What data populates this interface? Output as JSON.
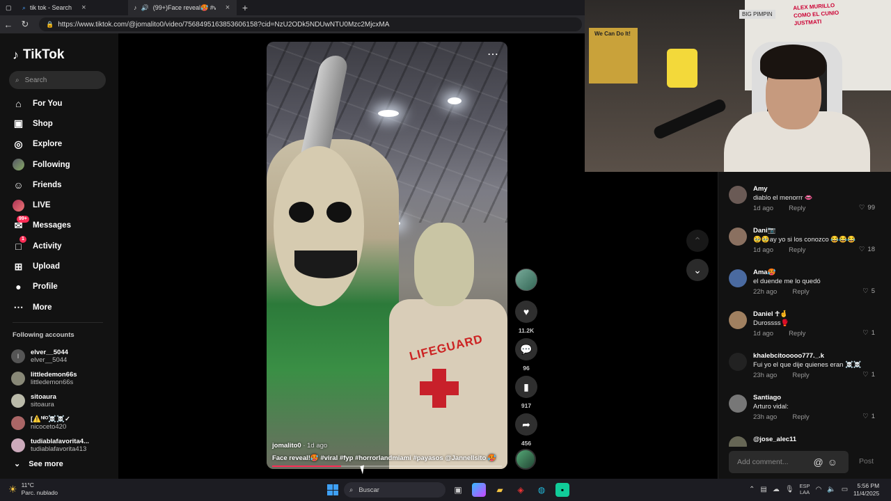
{
  "browser": {
    "tabs": [
      {
        "title": "tik tok - Search"
      },
      {
        "title": "(99+)Face reveal🥵 #viral #"
      }
    ],
    "new_tab": "+",
    "url": "https://www.tiktok.com/@jomalito0/video/7568495163853606158?cid=NzU2ODk5NDUwNTU0Mzc2MjcxMA"
  },
  "sidebar": {
    "logo": "TikTok",
    "search_placeholder": "Search",
    "nav": [
      {
        "label": "For You",
        "icon": "home-icon",
        "glyph": "⌂"
      },
      {
        "label": "Shop",
        "icon": "bag-icon",
        "glyph": "▣"
      },
      {
        "label": "Explore",
        "icon": "compass-icon",
        "glyph": "◎"
      },
      {
        "label": "Following",
        "icon": "following-avatar-icon",
        "glyph": ""
      },
      {
        "label": "Friends",
        "icon": "friends-icon",
        "glyph": "☺"
      },
      {
        "label": "LIVE",
        "icon": "live-avatar-icon",
        "glyph": ""
      },
      {
        "label": "Messages",
        "icon": "message-icon",
        "glyph": "✉",
        "badge": "99+"
      },
      {
        "label": "Activity",
        "icon": "bell-icon",
        "glyph": "□",
        "badge": "1"
      },
      {
        "label": "Upload",
        "icon": "upload-icon",
        "glyph": "⊞"
      },
      {
        "label": "Profile",
        "icon": "profile-icon",
        "glyph": "●"
      },
      {
        "label": "More",
        "icon": "more-icon",
        "glyph": "⋯"
      }
    ],
    "following_title": "Following accounts",
    "following": [
      {
        "name": "elver__5044",
        "handle": "elver__5044",
        "initial": "I"
      },
      {
        "name": "littledemon66s",
        "handle": "littledemon66s",
        "initial": ""
      },
      {
        "name": "sitoaura",
        "handle": "sitoaura",
        "initial": ""
      },
      {
        "name": "[⚠️ᴺˡᴼ☠️☠️✓",
        "handle": "nicoceto420",
        "initial": ""
      },
      {
        "name": "tudiablafavorita4...",
        "handle": "tudiablafavorita413",
        "initial": ""
      }
    ],
    "see_more": "See more"
  },
  "video": {
    "more": "⋯",
    "author": "jomalito0",
    "time": " · 1d ago",
    "caption": "Face reveal!🥵 #viral #fyp #horrorlandmiami #payasos @Jannellsito 🥵",
    "progress": 0.3,
    "shirt_text": "LIFEGUARD"
  },
  "actions": {
    "likes": "11.2K",
    "comments": "96",
    "saves": "917",
    "shares": "456"
  },
  "comments": [
    {
      "name": "Amy",
      "text": "diablo el menorrr 👄",
      "time": "1d ago",
      "reply": "Reply",
      "likes": "99"
    },
    {
      "name": "Dani📷",
      "text": "🥹🥹ay yo si los conozco 😂😂😂",
      "time": "1d ago",
      "reply": "Reply",
      "likes": "18"
    },
    {
      "name": "Ama🥵",
      "text": "el duende me lo quedó",
      "time": "22h ago",
      "reply": "Reply",
      "likes": "5"
    },
    {
      "name": "Daniel ☥️🤞",
      "text": "Durossss🥊",
      "time": "1d ago",
      "reply": "Reply",
      "likes": "1"
    },
    {
      "name": "khalebcitooooo777._.k",
      "text": "Fui yo el que dije quienes eran ☠️☠️",
      "time": "23h ago",
      "reply": "Reply",
      "likes": "1"
    },
    {
      "name": "Santiago",
      "text": "Arturo vidal:",
      "time": "23h ago",
      "reply": "Reply",
      "likes": "1"
    },
    {
      "name": "@jose_alec11",
      "text": "",
      "time": "",
      "reply": "",
      "likes": ""
    }
  ],
  "comment_box": {
    "placeholder": "Add comment...",
    "post": "Post"
  },
  "webcam": {
    "poster_text": "We Can Do It!",
    "sign_text": "BIG PIMPIN",
    "board_text": "ALEX MURILLO\nCOMO EL CUNIO\nJUSTMATI"
  },
  "taskbar": {
    "temp": "11°C",
    "weather": "Parc. nublado",
    "search": "Buscar",
    "lang_top": "ESP",
    "lang_bottom": "LAA",
    "time": "5:56 PM",
    "date": "11/4/2025"
  },
  "colors": {
    "accent": "#fe2c55",
    "bg": "#121212"
  }
}
